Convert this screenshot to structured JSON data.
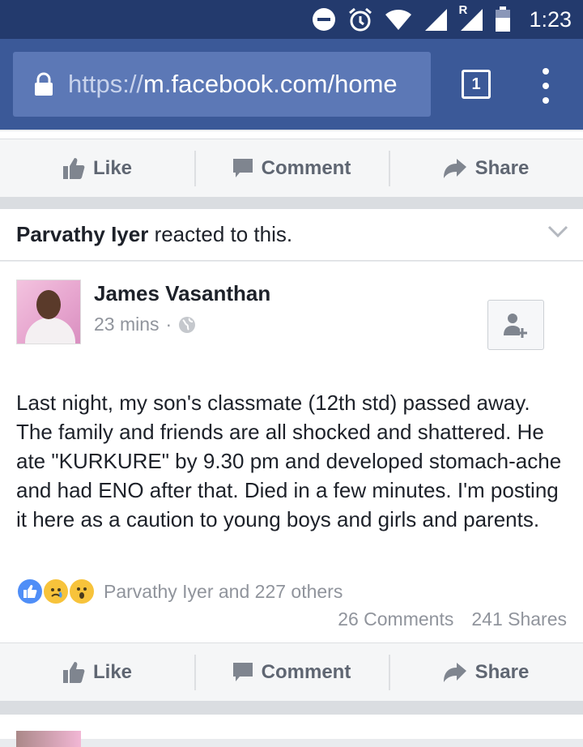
{
  "status_bar": {
    "time": "1:23",
    "roaming_label": "R"
  },
  "browser": {
    "url_scheme": "https://",
    "url_rest": "m.facebook.com/home",
    "tab_count": "1"
  },
  "top_actions": {
    "like": "Like",
    "comment": "Comment",
    "share": "Share"
  },
  "reacted_notice": {
    "name": "Parvathy Iyer",
    "text": "reacted to this."
  },
  "post": {
    "author": "James Vasanthan",
    "time": "23 mins",
    "separator": "·",
    "body": "Last night, my son's classmate (12th std) passed away. The family and friends are all shocked and shattered. He ate \"KURKURE\" by 9.30 pm and developed stomach-ache and had ENO after that. Died in a few minutes. I'm posting it here as a caution to young boys and girls and parents.",
    "reactions_text": "Parvathy Iyer and 227 others",
    "comments": "26 Comments",
    "shares": "241 Shares"
  },
  "bottom_actions": {
    "like": "Like",
    "comment": "Comment",
    "share": "Share"
  },
  "colors": {
    "status_bar": "#233a6d",
    "toolbar": "#3b5998",
    "url_field": "#5c78b6",
    "action_text": "#5f6672",
    "meta_text": "#90949c"
  }
}
